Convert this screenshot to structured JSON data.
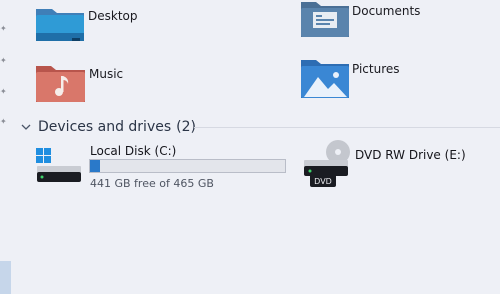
{
  "quick_access": [
    {
      "label": "Desktop",
      "icon": "desktop-folder-icon"
    },
    {
      "label": "Documents",
      "icon": "documents-folder-icon"
    },
    {
      "label": "Music",
      "icon": "music-folder-icon"
    },
    {
      "label": "Pictures",
      "icon": "pictures-folder-icon"
    }
  ],
  "devices": {
    "title": "Devices and drives",
    "count": "(2)",
    "drives": [
      {
        "name": "Local Disk (C:)",
        "free_text": "441 GB free of 465 GB",
        "used_fraction": 0.052,
        "icon": "local-disk-icon"
      },
      {
        "name": "DVD RW Drive (E:)",
        "icon": "dvd-drive-icon",
        "icon_text": "DVD"
      }
    ]
  },
  "colors": {
    "accent": "#2a79c9",
    "background": "#eef0f6"
  }
}
